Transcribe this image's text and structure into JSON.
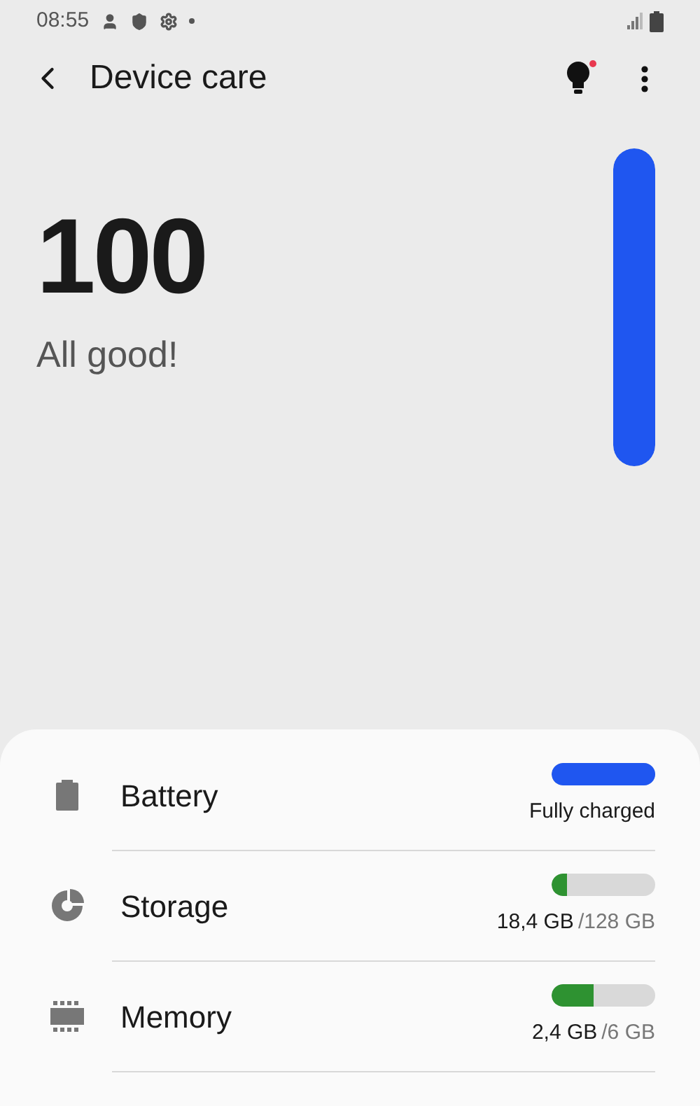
{
  "status_bar": {
    "time": "08:55"
  },
  "header": {
    "title": "Device care",
    "tips_badge": true
  },
  "score": {
    "value": "100",
    "status": "All good!",
    "level": 1
  },
  "items": [
    {
      "kind": "battery",
      "label": "Battery",
      "level": 1,
      "color": "#1f56f0",
      "status": "Fully charged"
    },
    {
      "kind": "storage",
      "label": "Storage",
      "level": 0.15,
      "color": "#2e9231",
      "used": "18,4 GB",
      "total": "/128 GB"
    },
    {
      "kind": "memory",
      "label": "Memory",
      "level": 0.4,
      "color": "#2e9231",
      "used": "2,4 GB",
      "total": "/6 GB"
    }
  ]
}
